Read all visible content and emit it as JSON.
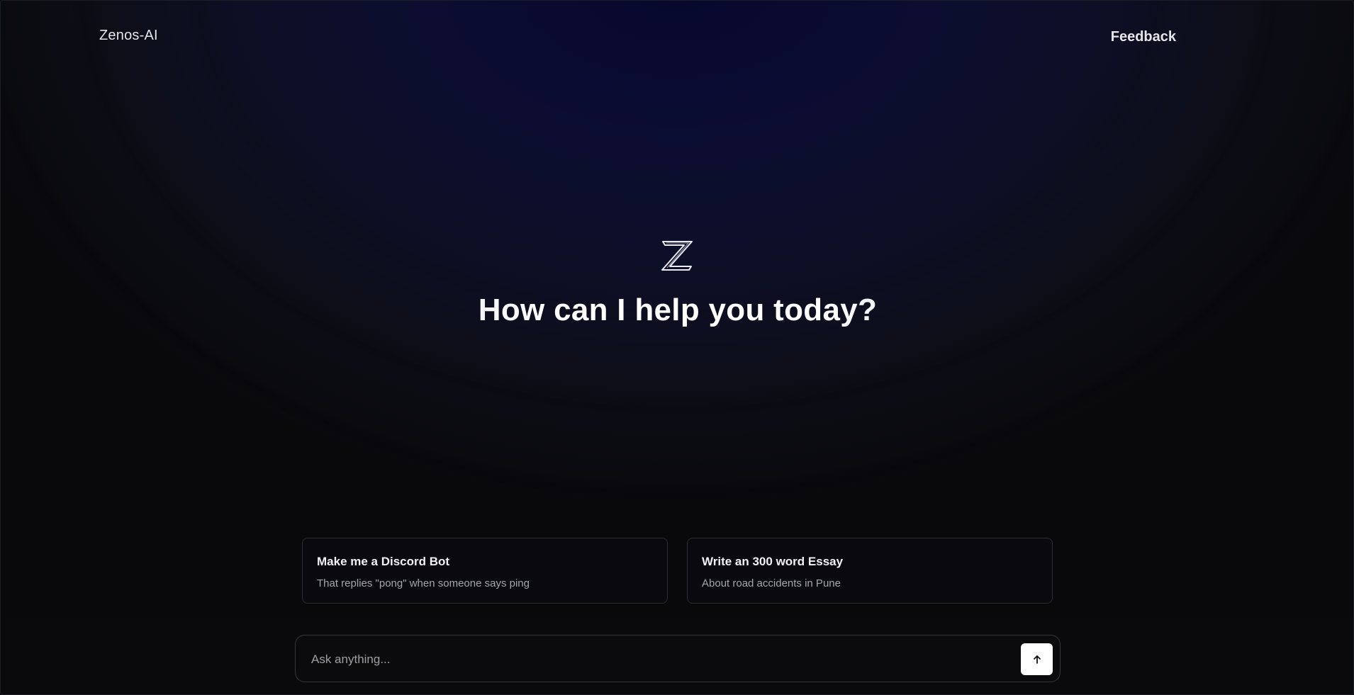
{
  "header": {
    "brand": "Zenos-AI",
    "feedback_label": "Feedback"
  },
  "hero": {
    "logo_icon": "zenos-z-logo",
    "headline": "How can I help you today?"
  },
  "suggestions": [
    {
      "title": "Make me a Discord Bot",
      "subtitle": "That replies \"pong\" when someone says ping"
    },
    {
      "title": "Write an 300 word Essay",
      "subtitle": "About road accidents in Pune"
    }
  ],
  "composer": {
    "placeholder": "Ask anything...",
    "send_icon": "arrow-up-icon"
  },
  "colors": {
    "background": "#09090c",
    "glow": "#0a0a37",
    "text": "#e6e6ea",
    "card_border": "#2a2d36",
    "send_button": "#ffffff"
  }
}
